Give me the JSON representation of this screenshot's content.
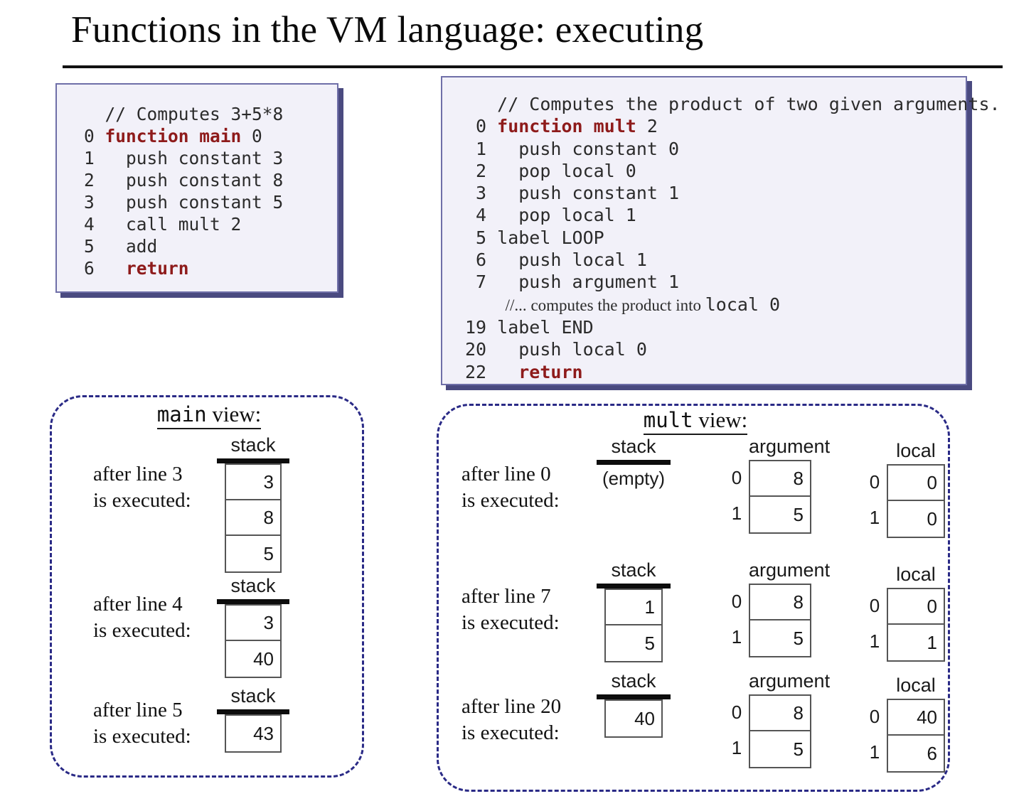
{
  "slide": {
    "title": "Functions in the VM language: executing"
  },
  "code_main": {
    "lines": [
      {
        "num": "",
        "text": "// Computes 3+5*8",
        "style": "comment"
      },
      {
        "num": "0",
        "kw": "function main",
        "after": " 0",
        "style": "kw"
      },
      {
        "num": "1",
        "text": "  push constant 3",
        "style": "plain"
      },
      {
        "num": "2",
        "text": "  push constant 8",
        "style": "plain"
      },
      {
        "num": "3",
        "text": "  push constant 5",
        "style": "plain"
      },
      {
        "num": "4",
        "text": "  call mult 2",
        "style": "plain"
      },
      {
        "num": "5",
        "text": "  add",
        "style": "plain"
      },
      {
        "num": "6",
        "kw": "  return",
        "after": "",
        "style": "kw"
      }
    ]
  },
  "code_mult": {
    "lines": [
      {
        "num": "",
        "text": "// Computes the product of two given arguments.",
        "style": "comment"
      },
      {
        "num": "0",
        "kw": "function mult",
        "after": " 2",
        "style": "kw"
      },
      {
        "num": "1",
        "text": "  push constant 0",
        "style": "plain"
      },
      {
        "num": "2",
        "text": "  pop local 0",
        "style": "plain"
      },
      {
        "num": "3",
        "text": "  push constant 1",
        "style": "plain"
      },
      {
        "num": "4",
        "text": "  pop local 1",
        "style": "plain"
      },
      {
        "num": "5",
        "text": "label LOOP",
        "style": "plain"
      },
      {
        "num": "6",
        "text": "  push local 1",
        "style": "plain"
      },
      {
        "num": "7",
        "text": "  push argument 1",
        "style": "plain"
      },
      {
        "num": "",
        "text": "  //...  computes the product into local 0",
        "style": "serif-note"
      },
      {
        "num": "19",
        "text": "label END",
        "style": "plain"
      },
      {
        "num": "20",
        "text": "  push local 0",
        "style": "plain"
      },
      {
        "num": "22",
        "kw": "  return",
        "after": "",
        "style": "kw"
      }
    ],
    "serif_note": {
      "prefix": "//...",
      "middle": " computes the product into ",
      "mono": "local 0"
    }
  },
  "main_view": {
    "heading_mono": "main",
    "heading_word": "view:",
    "snapshots": [
      {
        "caption_line1": "after line 3",
        "caption_line2": "is executed:",
        "stack_label": "stack",
        "stack_values": [
          "3",
          "8",
          "5"
        ]
      },
      {
        "caption_line1": "after line 4",
        "caption_line2": "is executed:",
        "stack_label": "stack",
        "stack_values": [
          "3",
          "40"
        ]
      },
      {
        "caption_line1": "after line 5",
        "caption_line2": "is executed:",
        "stack_label": "stack",
        "stack_values": [
          "43"
        ]
      }
    ]
  },
  "mult_view": {
    "heading_mono": "mult",
    "heading_word": "view:",
    "labels": {
      "stack": "stack",
      "argument": "argument",
      "local": "local",
      "empty": "(empty)"
    },
    "snapshots": [
      {
        "caption_line1": "after line 0",
        "caption_line2": "is executed:",
        "stack_values": [],
        "stack_empty_text": "(empty)",
        "argument_indices": [
          "0",
          "1"
        ],
        "argument_values": [
          "8",
          "5"
        ],
        "local_indices": [
          "0",
          "1"
        ],
        "local_values": [
          "0",
          "0"
        ]
      },
      {
        "caption_line1": "after line 7",
        "caption_line2": "is executed:",
        "stack_values": [
          "1",
          "5"
        ],
        "stack_empty_text": "",
        "argument_indices": [
          "0",
          "1"
        ],
        "argument_values": [
          "8",
          "5"
        ],
        "local_indices": [
          "0",
          "1"
        ],
        "local_values": [
          "0",
          "1"
        ]
      },
      {
        "caption_line1": "after line 20",
        "caption_line2": "is executed:",
        "stack_values": [
          "40"
        ],
        "stack_empty_text": "",
        "argument_indices": [
          "0",
          "1"
        ],
        "argument_values": [
          "8",
          "5"
        ],
        "local_indices": [
          "0",
          "1"
        ],
        "local_values": [
          "40",
          "6"
        ]
      }
    ]
  },
  "colors": {
    "keyword_red": "#8e1b1b",
    "code_box_border": "#6f6fa8",
    "code_box_bg": "#f2f1f9",
    "code_box_shadow": "#4a4a80",
    "panel_dash": "#2a2a86",
    "stack_bar": "#0d0d0d"
  }
}
